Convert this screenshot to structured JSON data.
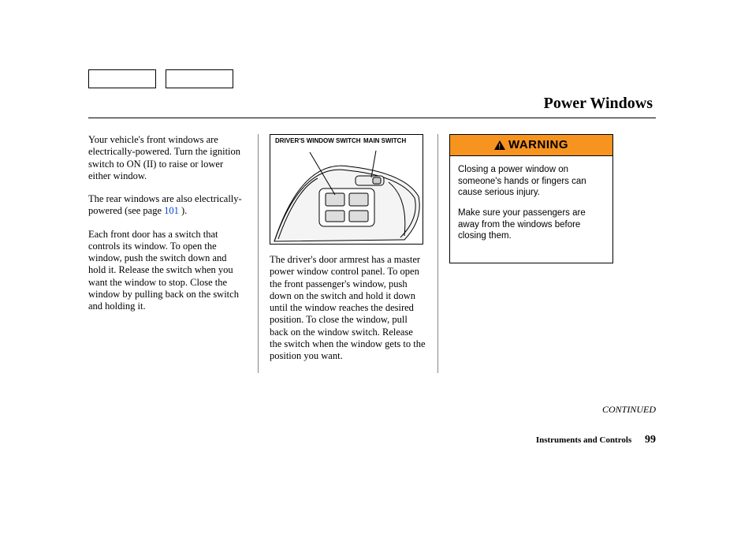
{
  "title": "Power Windows",
  "nav": [
    "",
    ""
  ],
  "col1": {
    "p1": "Your vehicle's front windows are electrically-powered. Turn the ignition switch to ON (II) to raise or lower either window.",
    "p2a": "The rear windows are also electrically-powered (see page ",
    "p2link": "101",
    "p2b": " ).",
    "p3": "Each front door has a switch that controls its window. To open the window, push the switch down and hold it. Release the switch when you want the window to stop. Close the window by pulling back on the switch and holding it."
  },
  "diagram": {
    "label1": "DRIVER'S WINDOW SWITCH",
    "label2": "MAIN SWITCH"
  },
  "col2": {
    "p1": "The driver's door armrest has a master power window control panel. To open the front passenger's window, push down on the switch and hold it down until the window reaches the desired position. To close the window, pull back on the window switch. Release the switch when the window gets to the position you want."
  },
  "warning": {
    "header": "WARNING",
    "p1": "Closing a power window on someone's hands or fingers can cause serious injury.",
    "p2": "Make sure your passengers are away from the windows before closing them."
  },
  "continued": "CONTINUED",
  "footer": {
    "section": "Instruments and Controls",
    "page": "99"
  }
}
